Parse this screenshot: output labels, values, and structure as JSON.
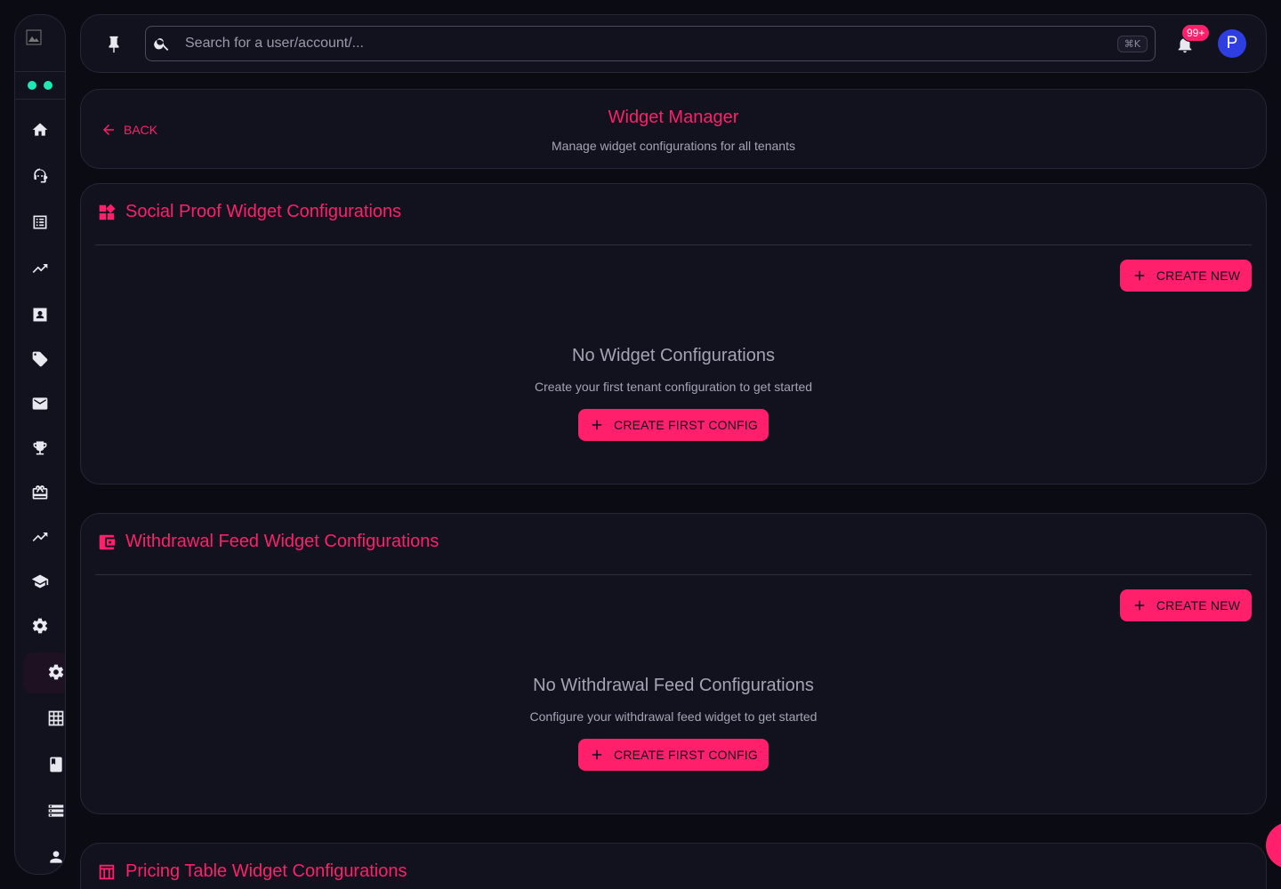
{
  "topbar": {
    "search_placeholder": "Search for a user/account/...",
    "search_shortcut": "⌘K",
    "notification_count": "99+",
    "avatar_letter": "P"
  },
  "header": {
    "back_label": "BACK",
    "title": "Widget Manager",
    "subtitle": "Manage widget configurations for all tenants"
  },
  "sections": [
    {
      "title": "Social Proof Widget Configurations",
      "create_label": "CREATE NEW",
      "empty_title": "No Widget Configurations",
      "empty_subtitle": "Create your first tenant configuration to get started",
      "first_config_label": "CREATE FIRST CONFIG"
    },
    {
      "title": "Withdrawal Feed Widget Configurations",
      "create_label": "CREATE NEW",
      "empty_title": "No Withdrawal Feed Configurations",
      "empty_subtitle": "Configure your withdrawal feed widget to get started",
      "first_config_label": "CREATE FIRST CONFIG"
    },
    {
      "title": "Pricing Table Widget Configurations"
    }
  ],
  "sidebar": {
    "icons": [
      "home-icon",
      "support-agent-icon",
      "list-icon",
      "trending-up-icon",
      "contact-card-icon",
      "tag-icon",
      "mail-icon",
      "trophy-icon",
      "gift-card-icon",
      "trending-up-icon",
      "school-icon",
      "settings-icon",
      "settings-active-icon",
      "grid-icon",
      "book-icon",
      "storage-icon",
      "person-icon"
    ]
  },
  "colors": {
    "accent": "#ff1f6a",
    "background": "#0b0b14",
    "card": "#12121f",
    "status_dot": "#1de9b6",
    "avatar": "#2f3ee0"
  }
}
